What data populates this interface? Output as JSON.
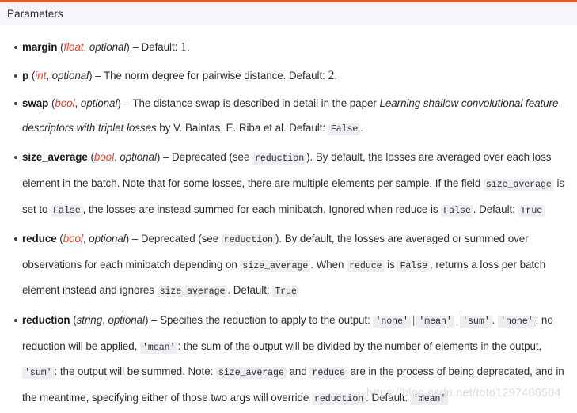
{
  "header": {
    "title": "Parameters",
    "accent_color": "#e8562a",
    "background_color": "#f4f6f9"
  },
  "watermark": {
    "text": "https://blog.csdn.net/toto1297488504",
    "color": "#d9dde1"
  },
  "colors": {
    "type_red": "#e8402b",
    "code_bg": "#eceef0",
    "text": "#2a2d30"
  },
  "parameters": [
    {
      "name": "margin",
      "type": "float",
      "type_styled": "red",
      "optional_label": "optional",
      "dash": "–",
      "seg": {
        "default_label": "Default:",
        "default_value": "1",
        "period": "."
      }
    },
    {
      "name": "p",
      "type": "int",
      "type_styled": "red",
      "optional_label": "optional",
      "dash": "–",
      "seg": {
        "text": "The norm degree for pairwise distance.",
        "default_label": "Default:",
        "default_value": "2",
        "period": "."
      }
    },
    {
      "name": "swap",
      "type": "bool",
      "type_styled": "red",
      "optional_label": "optional",
      "dash": "–",
      "seg": {
        "t1": "The distance swap is described in detail in the paper",
        "paper_title": "Learning shallow convolutional feature descriptors with triplet losses",
        "t2": "by V. Balntas, E. Riba et al. Default:",
        "code1": "False",
        "period": "."
      }
    },
    {
      "name": "size_average",
      "type": "bool",
      "type_styled": "red",
      "optional_label": "optional",
      "dash": "–",
      "seg": {
        "t1": "Deprecated (see",
        "code1": "reduction",
        "t2": "). By default, the losses are averaged over each loss element in the batch. Note that for some losses, there are multiple elements per sample. If the field",
        "code2": "size_average",
        "t3": "is set to",
        "code3": "False",
        "t4": ", the losses are instead summed for each minibatch. Ignored when reduce is",
        "code4": "False",
        "t5": ". Default:",
        "code5": "True"
      }
    },
    {
      "name": "reduce",
      "type": "bool",
      "type_styled": "red",
      "optional_label": "optional",
      "dash": "–",
      "seg": {
        "t1": "Deprecated (see",
        "code1": "reduction",
        "t2": "). By default, the losses are averaged or summed over observations for each minibatch depending on",
        "code2": "size_average",
        "t3": ". When",
        "code3": "reduce",
        "t4": "is",
        "code4": "False",
        "t5": ", returns a loss per batch element instead and ignores",
        "code5": "size_average",
        "t6": ". Default:",
        "code6": "True"
      }
    },
    {
      "name": "reduction",
      "type": "string",
      "type_styled": "plain",
      "optional_label": "optional",
      "dash": "–",
      "seg": {
        "t1": "Specifies the reduction to apply to the output:",
        "code1": "'none'",
        "pipe1": "|",
        "code2": "'mean'",
        "pipe2": "|",
        "code3": "'sum'",
        "t2": ".",
        "code4": "'none'",
        "t3": ": no reduction will be applied,",
        "code5": "'mean'",
        "t4": ": the sum of the output will be divided by the number of elements in the output,",
        "code6": "'sum'",
        "t5": ": the output will be summed. Note:",
        "code7": "size_average",
        "t6": "and",
        "code8": "reduce",
        "t7": "are in the process of being deprecated, and in the meantime, specifying either of those two args will override",
        "code9": "reduction",
        "t8": ". Default:",
        "code10": "'mean'"
      }
    }
  ]
}
